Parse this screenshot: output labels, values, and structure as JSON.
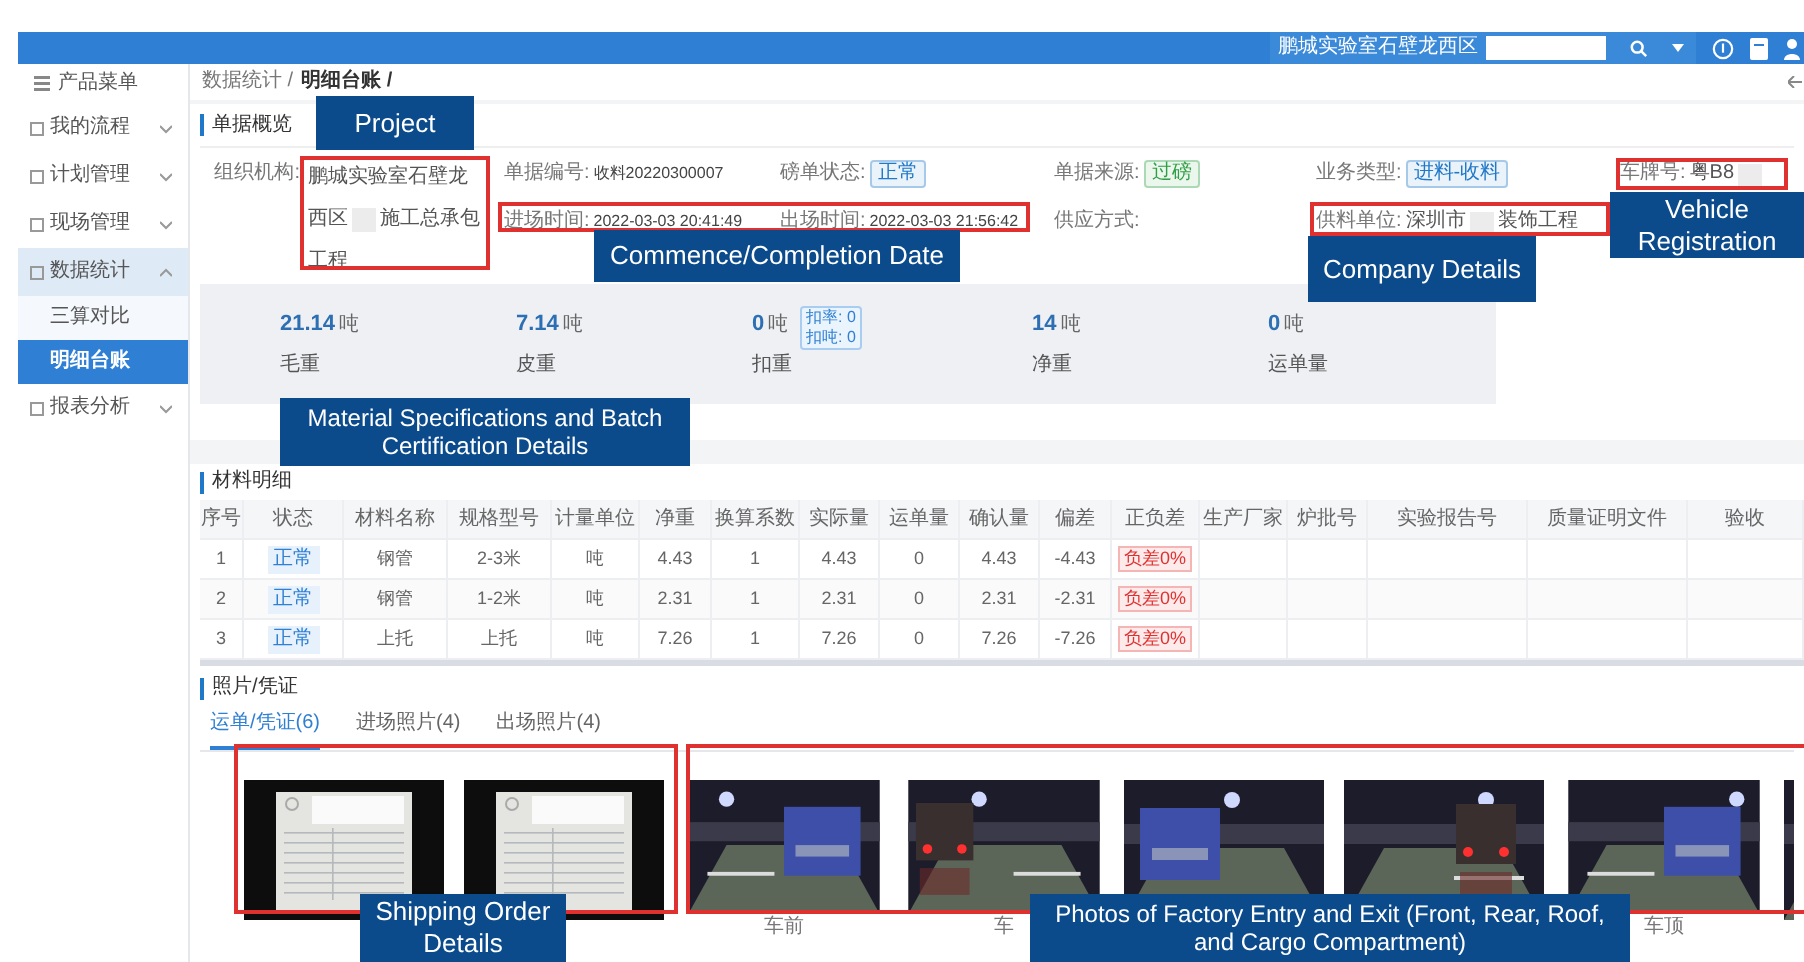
{
  "header": {
    "org_switch": "鹏城实验室石壁龙西区"
  },
  "sidebar": {
    "menu_title": "产品菜单",
    "items": [
      {
        "label": "我的流程",
        "expanded": false
      },
      {
        "label": "计划管理",
        "expanded": false
      },
      {
        "label": "现场管理",
        "expanded": false
      },
      {
        "label": "数据统计",
        "expanded": true,
        "children": [
          {
            "label": "三算对比",
            "selected": false
          },
          {
            "label": "明细台账",
            "selected": true
          }
        ]
      },
      {
        "label": "报表分析",
        "expanded": false
      }
    ]
  },
  "breadcrumb": [
    "数据统计 /",
    "明细台账 /"
  ],
  "overview": {
    "title": "单据概览",
    "organization": {
      "label": "组织机构:",
      "lines": [
        [
          "鹏城实验室石壁龙"
        ],
        [
          "西区",
          "施工总承包"
        ],
        [
          "工程"
        ]
      ]
    },
    "fields": [
      {
        "label": "单据编号:",
        "kind": "text",
        "value": "收料20220300007"
      },
      {
        "label": "磅单状态:",
        "kind": "tag",
        "value": "正常",
        "color": "#1f78c8"
      },
      {
        "label": "单据来源:",
        "kind": "tag",
        "value": "过磅",
        "color": "#2f9e44"
      },
      {
        "label": "业务类型:",
        "kind": "tag",
        "value": "进料-收料",
        "color": "#1f78c8"
      },
      {
        "label": "车牌号:",
        "kind": "masked",
        "parts": [
          "粤B8"
        ]
      },
      {
        "label": "进场时间:",
        "kind": "text",
        "value": "2022-03-03 20:41:49"
      },
      {
        "label": "出场时间:",
        "kind": "text",
        "value": "2022-03-03 21:56:42"
      },
      {
        "label": "供应方式:",
        "kind": "text"
      },
      {
        "label": "供料单位:",
        "kind": "masked",
        "parts": [
          "深圳市",
          "装饰工程"
        ]
      }
    ],
    "stats": [
      {
        "value": "21.14",
        "unit": "吨",
        "label": "毛重"
      },
      {
        "value": "7.14",
        "unit": "吨",
        "label": "皮重"
      },
      {
        "value": "0",
        "unit": "吨",
        "label": "扣重",
        "note": [
          "扣率: 0",
          "扣吨: 0"
        ]
      },
      {
        "value": "14",
        "unit": "吨",
        "label": "净重"
      },
      {
        "value": "0",
        "unit": "吨",
        "label": "运单量"
      }
    ]
  },
  "materials": {
    "title": "材料明细",
    "columns": [
      {
        "label": "序号",
        "kind": "text"
      },
      {
        "label": "状态",
        "kind": "status"
      },
      {
        "label": "材料名称",
        "kind": "text"
      },
      {
        "label": "规格型号",
        "kind": "text"
      },
      {
        "label": "计量单位",
        "kind": "text"
      },
      {
        "label": "净重",
        "kind": "text"
      },
      {
        "label": "换算系数",
        "kind": "text"
      },
      {
        "label": "实际量",
        "kind": "text"
      },
      {
        "label": "运单量",
        "kind": "text"
      },
      {
        "label": "确认量",
        "kind": "text"
      },
      {
        "label": "偏差",
        "kind": "text"
      },
      {
        "label": "正负差",
        "kind": "deviation"
      },
      {
        "label": "生产厂家"
      },
      {
        "label": "炉批号"
      },
      {
        "label": "实验报告号"
      },
      {
        "label": "质量证明文件"
      },
      {
        "label": "验收"
      }
    ],
    "rows": [
      [
        "1",
        "正常",
        "钢管",
        "2-3米",
        "吨",
        "4.43",
        "1",
        "4.43",
        "0",
        "4.43",
        "-4.43",
        "负差0%"
      ],
      [
        "2",
        "正常",
        "钢管",
        "1-2米",
        "吨",
        "2.31",
        "1",
        "2.31",
        "0",
        "2.31",
        "-2.31",
        "负差0%"
      ],
      [
        "3",
        "正常",
        "上托",
        "上托",
        "吨",
        "7.26",
        "1",
        "7.26",
        "0",
        "7.26",
        "-7.26",
        "负差0%"
      ]
    ]
  },
  "photos": {
    "title": "照片/凭证",
    "tabs": [
      {
        "label": "运单/凭证(6)",
        "selected": true
      },
      {
        "label": "进场照片(4)",
        "selected": false
      },
      {
        "label": "出场照片(4)",
        "selected": false
      }
    ],
    "shipping": [
      {
        "kind": "picture"
      },
      {
        "kind": "picture"
      }
    ],
    "vehicle": [
      {
        "kind": "picture",
        "caption": "车前"
      },
      {
        "kind": "picture",
        "caption": "车"
      },
      {
        "kind": "picture"
      },
      {
        "kind": "picture"
      },
      {
        "kind": "picture",
        "caption": "车顶"
      },
      {
        "kind": "picture"
      }
    ]
  },
  "annotations": [
    {
      "text": "Project"
    },
    {
      "text": "Commence/Completion Date"
    },
    {
      "text": "Material Specifications and Batch Certification Details"
    },
    {
      "text": "Company Details"
    },
    {
      "text": "Vehicle Registration"
    },
    {
      "text": "Shipping Order Details"
    },
    {
      "text": "Photos of Factory Entry and Exit (Front, Rear, Roof, and Cargo Compartment)"
    }
  ]
}
